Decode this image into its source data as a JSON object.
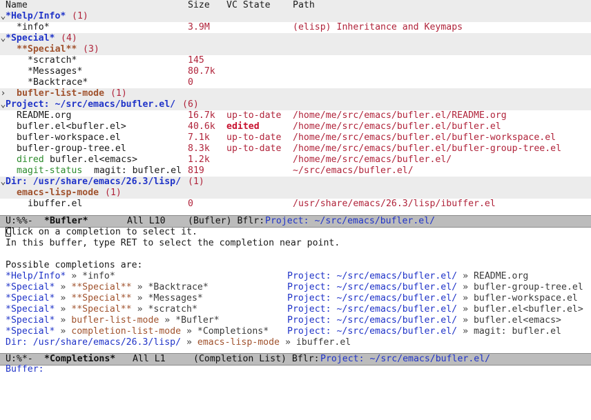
{
  "header": {
    "name": "Name",
    "size": "Size",
    "vc_state": "VC State",
    "path": "Path"
  },
  "rows": [
    {
      "fold": "⌄",
      "name": "*Help/Info*",
      "count": "(1)"
    },
    {
      "name": "*info*",
      "size": "3.9M",
      "path": "(elisp) Inheritance and Keymaps"
    },
    {
      "fold": "⌄",
      "name": "*Special*",
      "count": "(4)"
    },
    {
      "name": "**Special**",
      "count": "(3)"
    },
    {
      "name": "*scratch*",
      "size": "145"
    },
    {
      "name": "*Messages*",
      "size": "80.7k"
    },
    {
      "name": "*Backtrace*",
      "size": "0"
    },
    {
      "fold": "›",
      "name": "bufler-list-mode",
      "count": "(1)"
    },
    {
      "fold": "⌄",
      "name": "Project: ~/src/emacs/bufler.el/",
      "count": "(6)"
    },
    {
      "name": "README.org",
      "size": "16.7k",
      "vc": "up-to-date",
      "path": "/home/me/src/emacs/bufler.el/README.org"
    },
    {
      "name": "bufler.el<bufler.el>",
      "size": "40.6k",
      "vc": "edited",
      "path": "/home/me/src/emacs/bufler.el/bufler.el"
    },
    {
      "name": "bufler-workspace.el",
      "size": "7.1k",
      "vc": "up-to-date",
      "path": "/home/me/src/emacs/bufler.el/bufler-workspace.el"
    },
    {
      "name": "bufler-group-tree.el",
      "size": "8.3k",
      "vc": "up-to-date",
      "path": "/home/me/src/emacs/bufler.el/bufler-group-tree.el"
    },
    {
      "mode": "dired",
      "name": "bufler.el<emacs>",
      "size": "1.2k",
      "path": "/home/me/src/emacs/bufler.el/"
    },
    {
      "mode": "magit-status",
      "name": "magit: bufler.el",
      "size": "819",
      "path": "~/src/emacs/bufler.el/"
    },
    {
      "fold": "⌄",
      "name": "Dir: /usr/share/emacs/26.3/lisp/",
      "count": "(1)"
    },
    {
      "name": "emacs-lisp-mode",
      "count": "(1)"
    },
    {
      "name": "ibuffer.el",
      "size": "0",
      "path": "/usr/share/emacs/26.3/lisp/ibuffer.el"
    }
  ],
  "modeline1": {
    "state": "U:%%-",
    "buffer": "*Bufler*",
    "position": "All L10",
    "mode": "(Bufler) Bflr:",
    "project": "Project: ~/src/emacs/bufler.el/"
  },
  "completions": {
    "line1_rest": "lick on a completion to select it.",
    "line1_first": "C",
    "line2": "In this buffer, type RET to select the completion near point.",
    "possible": "Possible completions are:",
    "sep": "»",
    "left": [
      [
        {
          "t": "*Help/Info*",
          "c": "blue-n"
        },
        {
          "t": "*info*",
          "c": "dim"
        }
      ],
      [
        {
          "t": "*Special*",
          "c": "blue-n"
        },
        {
          "t": "**Special**",
          "c": "brown-n"
        },
        {
          "t": "*Backtrace*",
          "c": "dim"
        }
      ],
      [
        {
          "t": "*Special*",
          "c": "blue-n"
        },
        {
          "t": "**Special**",
          "c": "brown-n"
        },
        {
          "t": "*Messages*",
          "c": "dim"
        }
      ],
      [
        {
          "t": "*Special*",
          "c": "blue-n"
        },
        {
          "t": "**Special**",
          "c": "brown-n"
        },
        {
          "t": "*scratch*",
          "c": "dim"
        }
      ],
      [
        {
          "t": "*Special*",
          "c": "blue-n"
        },
        {
          "t": "bufler-list-mode",
          "c": "brown-n"
        },
        {
          "t": "*Bufler*",
          "c": "dim"
        }
      ],
      [
        {
          "t": "*Special*",
          "c": "blue-n"
        },
        {
          "t": "completion-list-mode",
          "c": "brown-n"
        },
        {
          "t": "*Completions*",
          "c": "dim"
        }
      ],
      [
        {
          "t": "Dir: /usr/share/emacs/26.3/lisp/",
          "c": "blue-n"
        },
        {
          "t": "emacs-lisp-mode",
          "c": "brown-n"
        },
        {
          "t": "ibuffer.el",
          "c": "dim"
        }
      ]
    ],
    "right": [
      [
        {
          "t": "Project: ~/src/emacs/bufler.el/",
          "c": "blue-n"
        },
        {
          "t": "README.org",
          "c": "dim"
        }
      ],
      [
        {
          "t": "Project: ~/src/emacs/bufler.el/",
          "c": "blue-n"
        },
        {
          "t": "bufler-group-tree.el",
          "c": "dim"
        }
      ],
      [
        {
          "t": "Project: ~/src/emacs/bufler.el/",
          "c": "blue-n"
        },
        {
          "t": "bufler-workspace.el",
          "c": "dim"
        }
      ],
      [
        {
          "t": "Project: ~/src/emacs/bufler.el/",
          "c": "blue-n"
        },
        {
          "t": "bufler.el<bufler.el>",
          "c": "dim"
        }
      ],
      [
        {
          "t": "Project: ~/src/emacs/bufler.el/",
          "c": "blue-n"
        },
        {
          "t": "bufler.el<emacs>",
          "c": "dim"
        }
      ],
      [
        {
          "t": "Project: ~/src/emacs/bufler.el/",
          "c": "blue-n"
        },
        {
          "t": "magit: bufler.el",
          "c": "dim"
        }
      ]
    ]
  },
  "modeline2": {
    "state": "U:%*-",
    "buffer": "*Completions*",
    "position": "All L1",
    "mode": "(Completion List) Bflr:",
    "project": "Project: ~/src/emacs/bufler.el/"
  },
  "minibuffer": {
    "prompt": "Buffer:"
  }
}
